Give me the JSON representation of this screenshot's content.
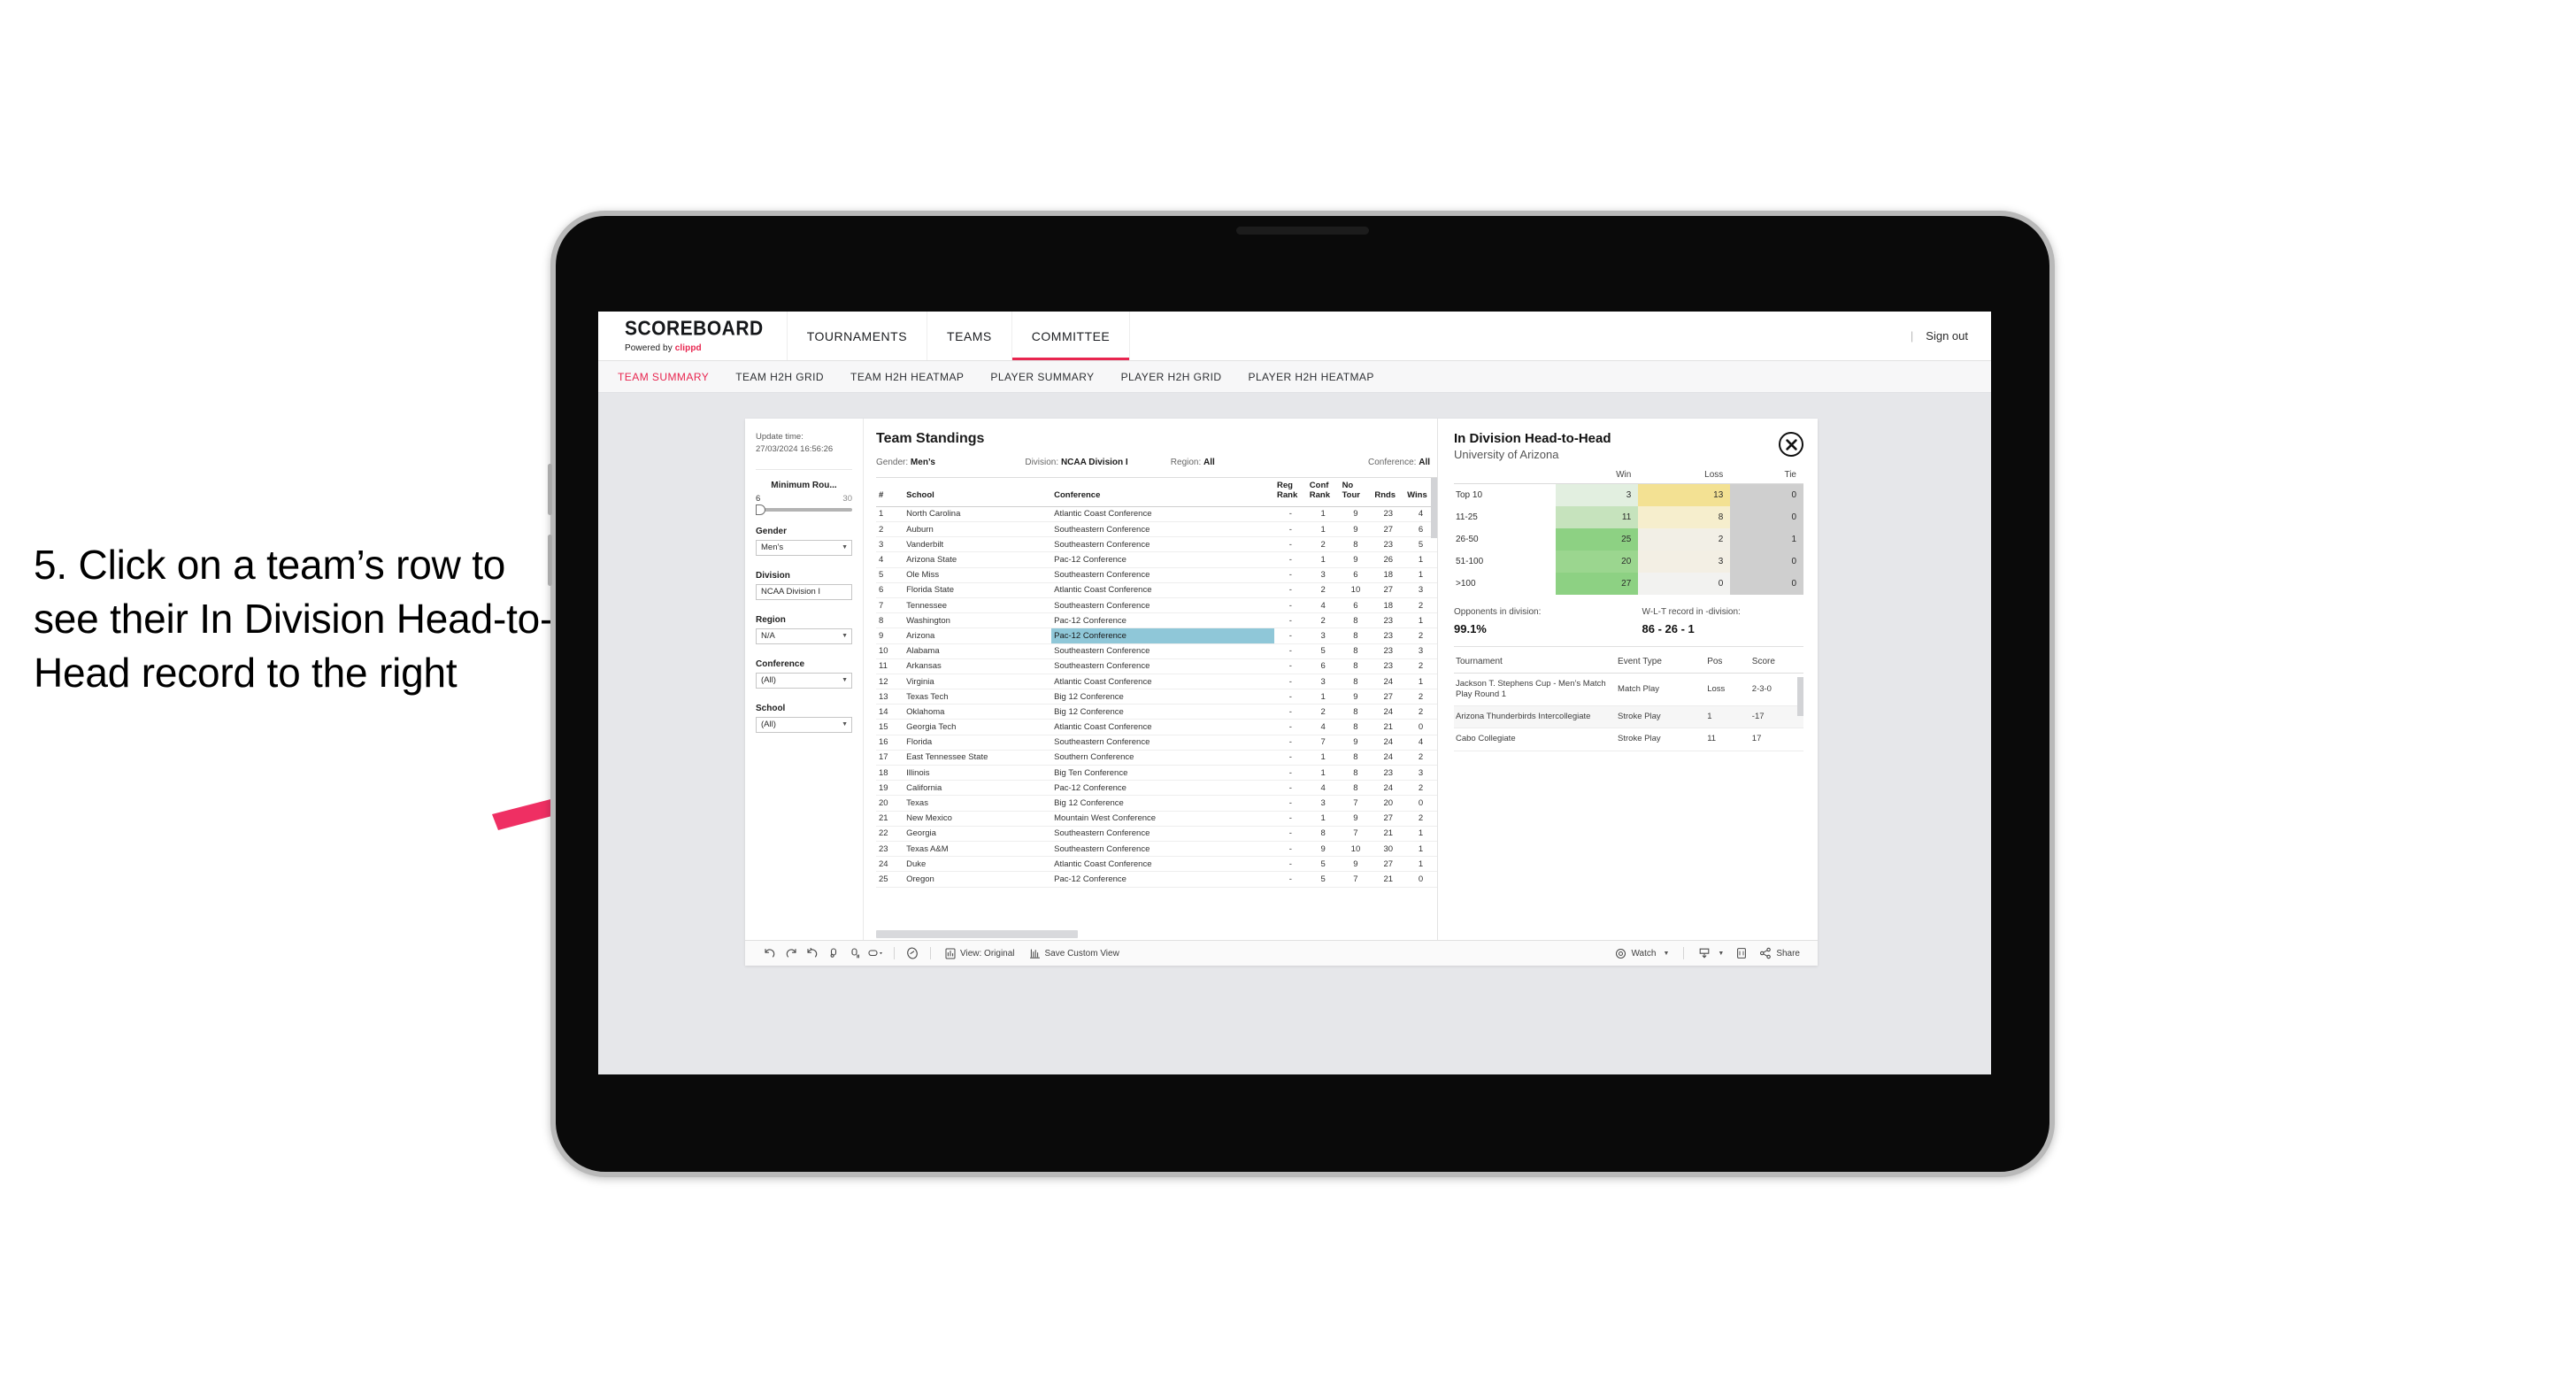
{
  "caption": "5. Click on a team’s row to see their In Division Head-to-Head record to the right",
  "accent": "#e8254f",
  "brand": {
    "title": "SCOREBOARD",
    "powered_prefix": "Powered by ",
    "powered_name": "clippd"
  },
  "topnav": {
    "items": [
      {
        "label": "TOURNAMENTS",
        "active": false
      },
      {
        "label": "TEAMS",
        "active": false
      },
      {
        "label": "COMMITTEE",
        "active": true
      }
    ],
    "divider": "|",
    "signout": "Sign out"
  },
  "subnav": {
    "tabs": [
      {
        "label": "TEAM SUMMARY",
        "active": true
      },
      {
        "label": "TEAM H2H GRID",
        "active": false
      },
      {
        "label": "TEAM H2H HEATMAP",
        "active": false
      },
      {
        "label": "PLAYER SUMMARY",
        "active": false
      },
      {
        "label": "PLAYER H2H GRID",
        "active": false
      },
      {
        "label": "PLAYER H2H HEATMAP",
        "active": false
      }
    ]
  },
  "filters": {
    "update_time_label": "Update time:",
    "update_time_value": "27/03/2024 16:56:26",
    "min_rounds": {
      "label": "Minimum Rou...",
      "min": "6",
      "max": "30"
    },
    "gender": {
      "label": "Gender",
      "value": "Men’s"
    },
    "division": {
      "label": "Division",
      "value": "NCAA Division I"
    },
    "region": {
      "label": "Region",
      "value": "N/A"
    },
    "conference": {
      "label": "Conference",
      "value": "(All)"
    },
    "school": {
      "label": "School",
      "value": "(All)"
    }
  },
  "standings": {
    "title": "Team Standings",
    "summary": [
      {
        "label": "Gender: ",
        "value": "Men’s"
      },
      {
        "label": "Division: ",
        "value": "NCAA Division I"
      },
      {
        "label": "Region: ",
        "value": "All"
      },
      {
        "label": "Conference: ",
        "value": "All"
      }
    ],
    "columns": [
      "#",
      "School",
      "Conference",
      "Reg Rank",
      "Conf Rank",
      "No Tour",
      "Rnds",
      "Wins"
    ],
    "rows": [
      {
        "num": "1",
        "school": "North Carolina",
        "conference": "Atlantic Coast Conference",
        "reg": "-",
        "conf": "1",
        "notour": "9",
        "rnds": "23",
        "wins": "4",
        "highlight": false
      },
      {
        "num": "2",
        "school": "Auburn",
        "conference": "Southeastern Conference",
        "reg": "-",
        "conf": "1",
        "notour": "9",
        "rnds": "27",
        "wins": "6",
        "highlight": false
      },
      {
        "num": "3",
        "school": "Vanderbilt",
        "conference": "Southeastern Conference",
        "reg": "-",
        "conf": "2",
        "notour": "8",
        "rnds": "23",
        "wins": "5",
        "highlight": false
      },
      {
        "num": "4",
        "school": "Arizona State",
        "conference": "Pac-12 Conference",
        "reg": "-",
        "conf": "1",
        "notour": "9",
        "rnds": "26",
        "wins": "1",
        "highlight": false
      },
      {
        "num": "5",
        "school": "Ole Miss",
        "conference": "Southeastern Conference",
        "reg": "-",
        "conf": "3",
        "notour": "6",
        "rnds": "18",
        "wins": "1",
        "highlight": false
      },
      {
        "num": "6",
        "school": "Florida State",
        "conference": "Atlantic Coast Conference",
        "reg": "-",
        "conf": "2",
        "notour": "10",
        "rnds": "27",
        "wins": "3",
        "highlight": false
      },
      {
        "num": "7",
        "school": "Tennessee",
        "conference": "Southeastern Conference",
        "reg": "-",
        "conf": "4",
        "notour": "6",
        "rnds": "18",
        "wins": "2",
        "highlight": false
      },
      {
        "num": "8",
        "school": "Washington",
        "conference": "Pac-12 Conference",
        "reg": "-",
        "conf": "2",
        "notour": "8",
        "rnds": "23",
        "wins": "1",
        "highlight": false
      },
      {
        "num": "9",
        "school": "Arizona",
        "conference": "Pac-12 Conference",
        "reg": "-",
        "conf": "3",
        "notour": "8",
        "rnds": "23",
        "wins": "2",
        "highlight": true
      },
      {
        "num": "10",
        "school": "Alabama",
        "conference": "Southeastern Conference",
        "reg": "-",
        "conf": "5",
        "notour": "8",
        "rnds": "23",
        "wins": "3",
        "highlight": false
      },
      {
        "num": "11",
        "school": "Arkansas",
        "conference": "Southeastern Conference",
        "reg": "-",
        "conf": "6",
        "notour": "8",
        "rnds": "23",
        "wins": "2",
        "highlight": false
      },
      {
        "num": "12",
        "school": "Virginia",
        "conference": "Atlantic Coast Conference",
        "reg": "-",
        "conf": "3",
        "notour": "8",
        "rnds": "24",
        "wins": "1",
        "highlight": false
      },
      {
        "num": "13",
        "school": "Texas Tech",
        "conference": "Big 12 Conference",
        "reg": "-",
        "conf": "1",
        "notour": "9",
        "rnds": "27",
        "wins": "2",
        "highlight": false
      },
      {
        "num": "14",
        "school": "Oklahoma",
        "conference": "Big 12 Conference",
        "reg": "-",
        "conf": "2",
        "notour": "8",
        "rnds": "24",
        "wins": "2",
        "highlight": false
      },
      {
        "num": "15",
        "school": "Georgia Tech",
        "conference": "Atlantic Coast Conference",
        "reg": "-",
        "conf": "4",
        "notour": "8",
        "rnds": "21",
        "wins": "0",
        "highlight": false
      },
      {
        "num": "16",
        "school": "Florida",
        "conference": "Southeastern Conference",
        "reg": "-",
        "conf": "7",
        "notour": "9",
        "rnds": "24",
        "wins": "4",
        "highlight": false
      },
      {
        "num": "17",
        "school": "East Tennessee State",
        "conference": "Southern Conference",
        "reg": "-",
        "conf": "1",
        "notour": "8",
        "rnds": "24",
        "wins": "2",
        "highlight": false
      },
      {
        "num": "18",
        "school": "Illinois",
        "conference": "Big Ten Conference",
        "reg": "-",
        "conf": "1",
        "notour": "8",
        "rnds": "23",
        "wins": "3",
        "highlight": false
      },
      {
        "num": "19",
        "school": "California",
        "conference": "Pac-12 Conference",
        "reg": "-",
        "conf": "4",
        "notour": "8",
        "rnds": "24",
        "wins": "2",
        "highlight": false
      },
      {
        "num": "20",
        "school": "Texas",
        "conference": "Big 12 Conference",
        "reg": "-",
        "conf": "3",
        "notour": "7",
        "rnds": "20",
        "wins": "0",
        "highlight": false
      },
      {
        "num": "21",
        "school": "New Mexico",
        "conference": "Mountain West Conference",
        "reg": "-",
        "conf": "1",
        "notour": "9",
        "rnds": "27",
        "wins": "2",
        "highlight": false
      },
      {
        "num": "22",
        "school": "Georgia",
        "conference": "Southeastern Conference",
        "reg": "-",
        "conf": "8",
        "notour": "7",
        "rnds": "21",
        "wins": "1",
        "highlight": false
      },
      {
        "num": "23",
        "school": "Texas A&M",
        "conference": "Southeastern Conference",
        "reg": "-",
        "conf": "9",
        "notour": "10",
        "rnds": "30",
        "wins": "1",
        "highlight": false
      },
      {
        "num": "24",
        "school": "Duke",
        "conference": "Atlantic Coast Conference",
        "reg": "-",
        "conf": "5",
        "notour": "9",
        "rnds": "27",
        "wins": "1",
        "highlight": false
      },
      {
        "num": "25",
        "school": "Oregon",
        "conference": "Pac-12 Conference",
        "reg": "-",
        "conf": "5",
        "notour": "7",
        "rnds": "21",
        "wins": "0",
        "highlight": false
      }
    ]
  },
  "h2h": {
    "title": "In Division Head-to-Head",
    "subtitle": "University of Arizona",
    "close_icon": "×",
    "columns": [
      "",
      "Win",
      "Loss",
      "Tie"
    ],
    "rows": [
      {
        "band": "Top 10",
        "win": "3",
        "loss": "13",
        "tie": "0",
        "win_bg": "#e2efe0",
        "loss_bg": "#f3e193",
        "tie_bg": "#cfcfcf"
      },
      {
        "band": "11-25",
        "win": "11",
        "loss": "8",
        "tie": "0",
        "win_bg": "#c6e3bd",
        "loss_bg": "#f6eecd",
        "tie_bg": "#cfcfcf"
      },
      {
        "band": "26-50",
        "win": "25",
        "loss": "2",
        "tie": "1",
        "win_bg": "#8dd183",
        "loss_bg": "#f2efe6",
        "tie_bg": "#cfcfcf"
      },
      {
        "band": "51-100",
        "win": "20",
        "loss": "3",
        "tie": "0",
        "win_bg": "#9bd68f",
        "loss_bg": "#f3efe4",
        "tie_bg": "#cfcfcf"
      },
      {
        "band": ">100",
        "win": "27",
        "loss": "0",
        "tie": "0",
        "win_bg": "#8dd183",
        "loss_bg": "#f2f2f0",
        "tie_bg": "#cfcfcf"
      }
    ],
    "stats": [
      {
        "label": "Opponents in division:",
        "value": "99.1%"
      },
      {
        "label": "W-L-T record in -division:",
        "value": "86 - 26 - 1"
      }
    ],
    "tournament_columns": [
      "Tournament",
      "Event Type",
      "Pos",
      "Score"
    ],
    "tournaments": [
      {
        "name": "Jackson T. Stephens Cup - Men’s Match Play Round 1",
        "type": "Match Play",
        "pos": "Loss",
        "score": "2-3-0"
      },
      {
        "name": "Arizona Thunderbirds Intercollegiate",
        "type": "Stroke Play",
        "pos": "1",
        "score": "-17"
      },
      {
        "name": "Cabo Collegiate",
        "type": "Stroke Play",
        "pos": "11",
        "score": "17"
      }
    ]
  },
  "toolbar": {
    "view_label": "View: Original",
    "save_label": "Save Custom View",
    "watch_label": "Watch",
    "share_label": "Share"
  }
}
